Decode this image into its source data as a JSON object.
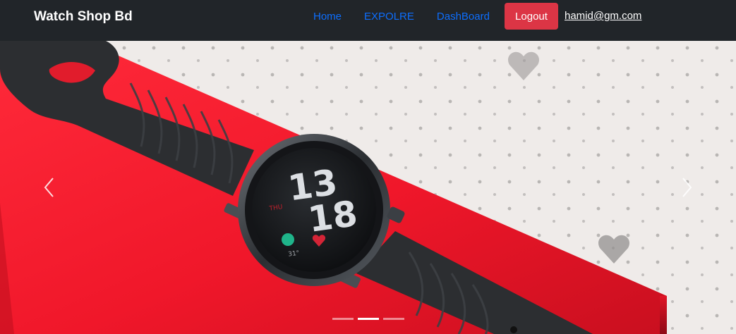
{
  "navbar": {
    "brand": "Watch Shop Bd",
    "links": [
      {
        "label": "Home"
      },
      {
        "label": "EXPOLRE"
      },
      {
        "label": "DashBoard"
      }
    ],
    "logout_label": "Logout",
    "user_email": "hamid@gm.com",
    "colors": {
      "background": "#212529",
      "link": "#0d6efd",
      "logout": "#dc3545"
    }
  },
  "carousel": {
    "image": "smartwatch-on-red-box",
    "watch_face": {
      "hour": "13",
      "minute": "18",
      "date_label": "THU",
      "temp_label": "31°"
    },
    "prev_icon": "chevron-left-icon",
    "next_icon": "chevron-right-icon",
    "slide_count": 3,
    "active_slide": 2
  }
}
